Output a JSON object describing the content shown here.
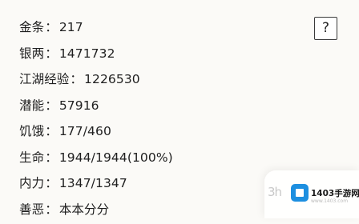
{
  "stats": [
    {
      "label": "金条",
      "sep": "：",
      "value": "217"
    },
    {
      "label": "银两",
      "sep": "：",
      "value": "1471732"
    },
    {
      "label": "江湖经验",
      "sep": "：",
      "value": "1226530"
    },
    {
      "label": "潜能",
      "sep": "：",
      "value": "57916"
    },
    {
      "label": "饥饿",
      "sep": "：",
      "value": "177/460"
    },
    {
      "label": "生命",
      "sep": "：",
      "value": "1944/1944(100%)"
    },
    {
      "label": "内力",
      "sep": "：",
      "value": "1347/1347"
    },
    {
      "label": "善恶",
      "sep": "：",
      "value": "本本分分"
    }
  ],
  "help_button": {
    "label": "?"
  },
  "watermark": {
    "site": "1403手游网",
    "tag": "3h",
    "sub": "www.1403.com"
  }
}
